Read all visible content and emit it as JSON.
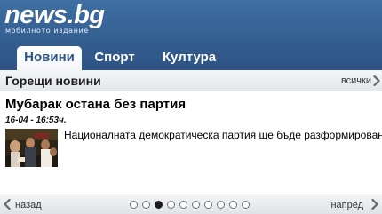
{
  "header": {
    "logo_text": "news.bg",
    "logo_subtitle": "мобилното издание"
  },
  "tabs": [
    {
      "label": "Новини",
      "active": true
    },
    {
      "label": "Спорт",
      "active": false
    },
    {
      "label": "Култура",
      "active": false
    }
  ],
  "section": {
    "title": "Горещи новини",
    "all_label": "всички"
  },
  "article": {
    "title": "Мубарак остана без партия",
    "date": "16-04 - 16:53ч.",
    "summary": "Националната демократическа партия ще бъде разформирована, а"
  },
  "footer": {
    "prev_label": "назад",
    "next_label": "напред",
    "page_count": 10,
    "current_page": 3
  },
  "colors": {
    "header_blue": "#345f91",
    "active_tab_text": "#2d5384"
  },
  "icons": [
    "chevron-right-icon",
    "chevron-left-icon",
    "news-photo-thumbnail"
  ]
}
